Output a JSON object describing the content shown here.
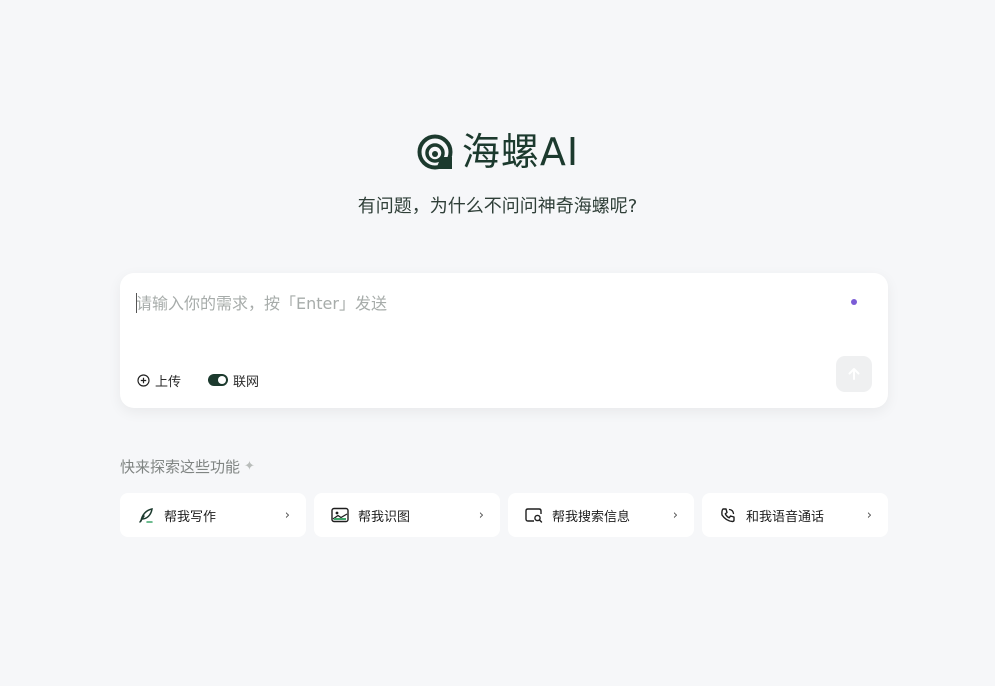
{
  "brand": {
    "name": "海螺AI",
    "tagline": "有问题，为什么不问问神奇海螺呢?"
  },
  "composer": {
    "placeholder": "请输入你的需求，按「Enter」发送",
    "upload_label": "上传",
    "web_label": "联网",
    "web_enabled": true
  },
  "explore": {
    "title": "快来探索这些功能",
    "items": [
      {
        "label": "帮我写作",
        "icon": "feather-pen-icon"
      },
      {
        "label": "帮我识图",
        "icon": "image-icon"
      },
      {
        "label": "帮我搜索信息",
        "icon": "search-window-icon"
      },
      {
        "label": "和我语音通话",
        "icon": "phone-icon"
      }
    ]
  },
  "colors": {
    "brand": "#1c3a2e",
    "accent_dot": "#7b5cd6",
    "background": "#f6f7f9"
  }
}
